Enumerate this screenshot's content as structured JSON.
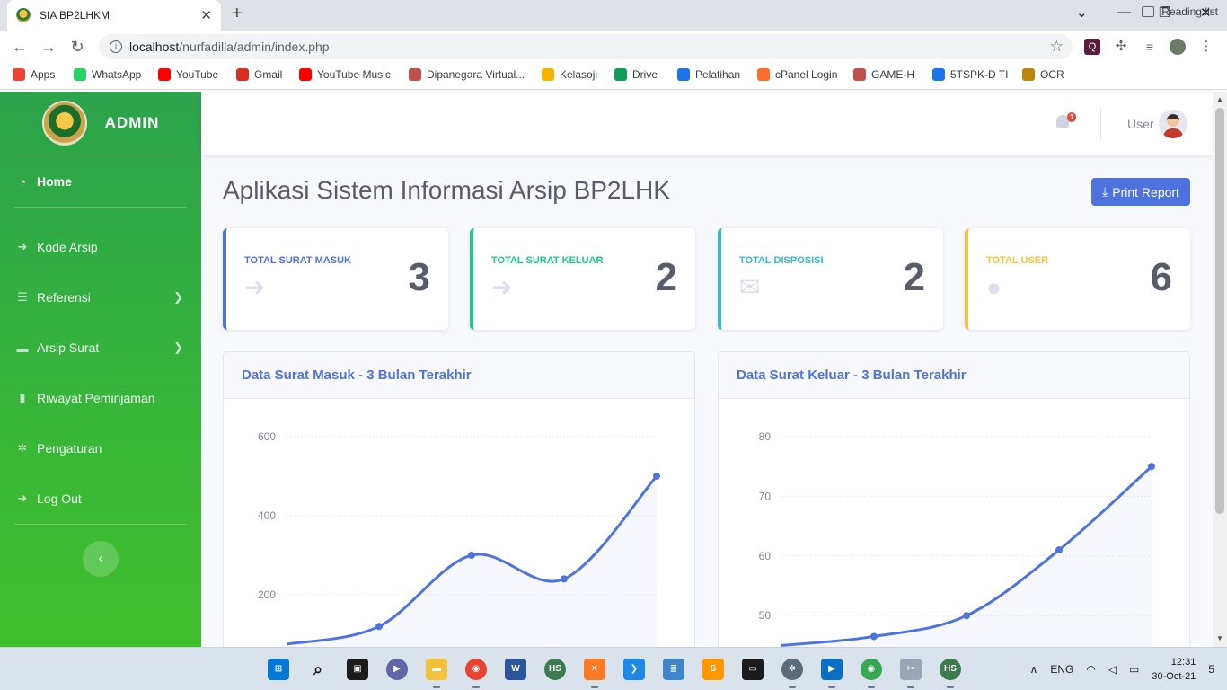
{
  "browser": {
    "tab_title": "SIA BP2LHKM",
    "url_host": "localhost",
    "url_path": "/nurfadilla/admin/index.php",
    "bookmarks": [
      {
        "label": "Apps",
        "color": "#ea4335",
        "icon": "apps-grid-icon"
      },
      {
        "label": "WhatsApp",
        "color": "#25d366",
        "icon": "whatsapp-icon"
      },
      {
        "label": "YouTube",
        "color": "#ff0000",
        "icon": "youtube-icon"
      },
      {
        "label": "Gmail",
        "color": "#d93025",
        "icon": "gmail-icon"
      },
      {
        "label": "YouTube Music",
        "color": "#ff0000",
        "icon": "youtube-music-icon"
      },
      {
        "label": "Dipanegara Virtual...",
        "color": "#c0504d",
        "icon": "campus-icon"
      },
      {
        "label": "Kelasoji",
        "color": "#f4b400",
        "icon": "classroom-icon"
      },
      {
        "label": "Drive",
        "color": "#0f9d58",
        "icon": "drive-icon"
      },
      {
        "label": "Pelatihan",
        "color": "#1a73e8",
        "icon": "edge-icon"
      },
      {
        "label": "cPanel Login",
        "color": "#ff6c2c",
        "icon": "cpanel-icon"
      },
      {
        "label": "GAME-H",
        "color": "#c0504d",
        "icon": "campus-icon"
      },
      {
        "label": "5TSPK-D TI",
        "color": "#1a73e8",
        "icon": "profile-icon"
      },
      {
        "label": "OCR",
        "color": "#b8860b",
        "icon": "emblem-icon"
      }
    ],
    "reading_list": "Reading list"
  },
  "sidebar": {
    "brand": "ADMIN",
    "items": [
      {
        "label": "Home",
        "icon": "dashboard-icon",
        "glyph": "◔"
      },
      {
        "label": "Kode Arsip",
        "icon": "sign-in-icon",
        "glyph": "➜"
      },
      {
        "label": "Referensi",
        "icon": "list-icon",
        "glyph": "☰"
      },
      {
        "label": "Arsip Surat",
        "icon": "folder-icon",
        "glyph": "▬"
      },
      {
        "label": "Riwayat Peminjaman",
        "icon": "clipboard-icon",
        "glyph": "▮"
      },
      {
        "label": "Pengaturan",
        "icon": "gear-icon",
        "glyph": "✲"
      },
      {
        "label": "Log Out",
        "icon": "sign-out-icon",
        "glyph": "➜"
      }
    ],
    "toggle_glyph": "‹"
  },
  "topbar": {
    "notification_count": "1",
    "user_label": "User"
  },
  "main": {
    "title": "Aplikasi Sistem Informasi Arsip BP2LHK",
    "print_button": "Print Report",
    "print_glyph": "⤓",
    "stats": [
      {
        "label": "TOTAL SURAT MASUK",
        "value": "3",
        "color": "#4e73df",
        "icon": "sign-in-icon",
        "glyph": "➜"
      },
      {
        "label": "TOTAL SURAT KELUAR",
        "value": "2",
        "color": "#1cc88a",
        "icon": "sign-out-icon",
        "glyph": "➜"
      },
      {
        "label": "TOTAL DISPOSISI",
        "value": "2",
        "color": "#36b9cc",
        "icon": "envelope-open-icon",
        "glyph": "✉"
      },
      {
        "label": "TOTAL USER",
        "value": "6",
        "color": "#f6c23e",
        "icon": "user-icon",
        "glyph": "●"
      }
    ]
  },
  "chart_data": [
    {
      "type": "line",
      "title": "Data Surat Masuk - 3 Bulan Terakhir",
      "x": [
        0,
        1,
        2,
        3,
        4
      ],
      "values": [
        75,
        120,
        300,
        240,
        500
      ],
      "yticks": [
        200,
        400,
        600
      ],
      "ylim": [
        0,
        600
      ],
      "grid": true,
      "color": "#4e73df"
    },
    {
      "type": "line",
      "title": "Data Surat Keluar - 3 Bulan Terakhir",
      "x": [
        0,
        1,
        2,
        3,
        4
      ],
      "values": [
        45,
        46.5,
        50,
        61,
        75
      ],
      "yticks": [
        50,
        60,
        70,
        80
      ],
      "ylim": [
        40,
        80
      ],
      "grid": true,
      "color": "#4e73df"
    }
  ],
  "taskbar": {
    "language": "ENG",
    "time": "12:31",
    "date": "30-Oct-21",
    "notifications": "5"
  }
}
